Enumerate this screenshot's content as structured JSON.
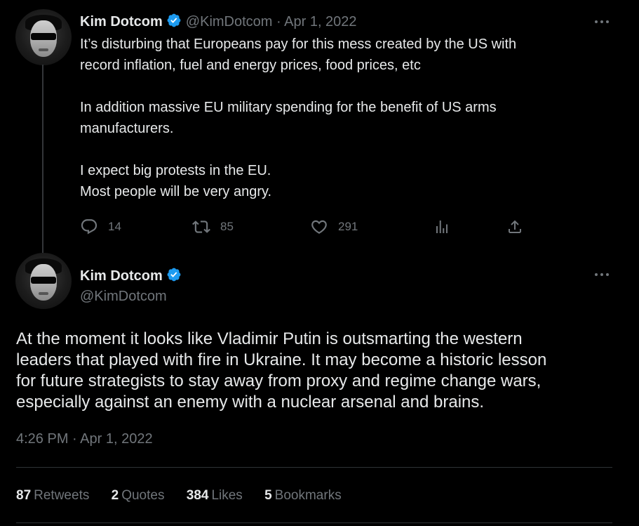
{
  "quoted_tweet": {
    "author_name": "Kim Dotcom",
    "handle": "@KimDotcom",
    "separator": "·",
    "date": "Apr 1, 2022",
    "body": {
      "p1_line1": "It’s disturbing that Europeans pay for this mess created by the US with",
      "p1_line2": "record inflation, fuel and energy prices, food prices, etc",
      "p2_line1": "In addition massive EU military spending for the benefit of US arms",
      "p2_line2": "manufacturers.",
      "p3_line1": "I expect big protests in the EU.",
      "p3_line2": "Most people will be very angry."
    },
    "actions": {
      "replies": "14",
      "retweets": "85",
      "likes": "291"
    },
    "icons": [
      "reply-icon",
      "retweet-icon",
      "like-icon",
      "views-icon",
      "share-icon",
      "more-icon"
    ]
  },
  "main_tweet": {
    "author_name": "Kim Dotcom",
    "handle": "@KimDotcom",
    "text_line1": "At the moment it looks like Vladimir Putin is outsmarting the western",
    "text_line2": "leaders that played with fire in Ukraine. It may become a historic lesson",
    "text_line3": "for future strategists to stay away from proxy and regime change wars,",
    "text_line4": "especially against an enemy with a nuclear arsenal and brains.",
    "timestamp": "4:26 PM · Apr 1, 2022",
    "stats": {
      "retweets_count": "87",
      "retweets_label": "Retweets",
      "quotes_count": "2",
      "quotes_label": "Quotes",
      "likes_count": "384",
      "likes_label": "Likes",
      "bookmarks_count": "5",
      "bookmarks_label": "Bookmarks"
    }
  },
  "colors": {
    "background": "#000000",
    "text": "#e7e9ea",
    "muted": "#71767b",
    "verified": "#1d9bf0",
    "divider": "#2f3336"
  }
}
